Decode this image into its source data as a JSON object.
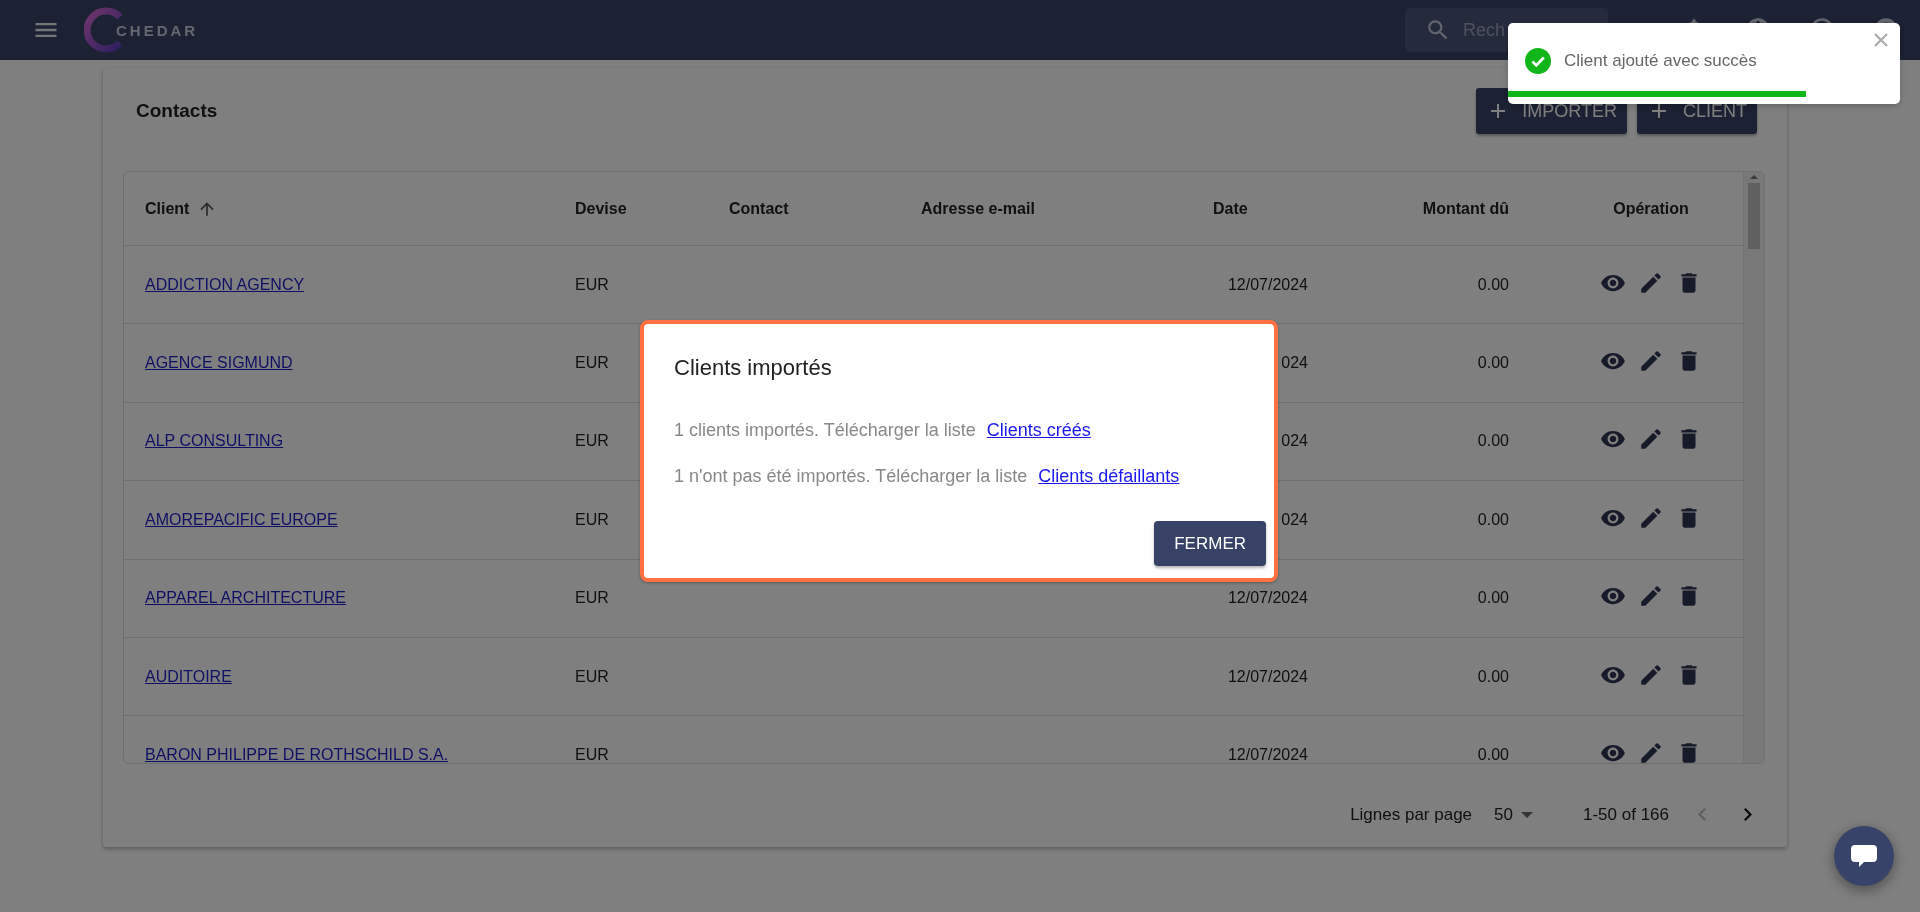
{
  "topbar": {
    "brand": "CHEDAR",
    "search": {
      "placeholder": "Rech"
    }
  },
  "page": {
    "title": "Contacts",
    "actions": [
      {
        "label": "IMPORTER"
      },
      {
        "label": "CLIENT"
      }
    ]
  },
  "table": {
    "columns": [
      {
        "label": "Client",
        "sorted": true
      },
      {
        "label": "Devise",
        "sorted": false
      },
      {
        "label": "Contact",
        "sorted": false
      },
      {
        "label": "Adresse e-mail",
        "sorted": false
      },
      {
        "label": "Date",
        "sorted": false
      },
      {
        "label": "Montant dû",
        "sorted": false
      },
      {
        "label": "Opération",
        "sorted": false
      }
    ],
    "rows": [
      {
        "client": "ADDICTION AGENCY",
        "currency": "EUR",
        "date": "12/07/2024",
        "amount": "0.00"
      },
      {
        "client": "AGENCE SIGMUND",
        "currency": "EUR",
        "date": "024",
        "amount": "0.00"
      },
      {
        "client": "ALP CONSULTING",
        "currency": "EUR",
        "date": "024",
        "amount": "0.00"
      },
      {
        "client": "AMOREPACIFIC EUROPE",
        "currency": "EUR",
        "date": "024",
        "amount": "0.00"
      },
      {
        "client": "APPAREL ARCHITECTURE",
        "currency": "EUR",
        "date": "12/07/2024",
        "amount": "0.00"
      },
      {
        "client": "AUDITOIRE",
        "currency": "EUR",
        "date": "12/07/2024",
        "amount": "0.00"
      },
      {
        "client": "BARON PHILIPPE DE ROTHSCHILD S.A.",
        "currency": "EUR",
        "date": "12/07/2024",
        "amount": "0.00"
      }
    ]
  },
  "pagination": {
    "rows_label": "Lignes par page",
    "rows_value": "50",
    "range": "1-50 of 166",
    "previous": {
      "disabled": true
    },
    "next": {
      "disabled": false
    }
  },
  "dialog": {
    "title": "Clients importés",
    "lines": [
      {
        "text": "1 clients importés. Télécharger la liste",
        "link": "Clients créés"
      },
      {
        "text": "1 n'ont pas été importés. Télécharger la liste",
        "link": "Clients défaillants"
      }
    ],
    "button": "FERMER"
  },
  "toast": {
    "message": "Client ajouté avec succès",
    "level": 0.76
  }
}
